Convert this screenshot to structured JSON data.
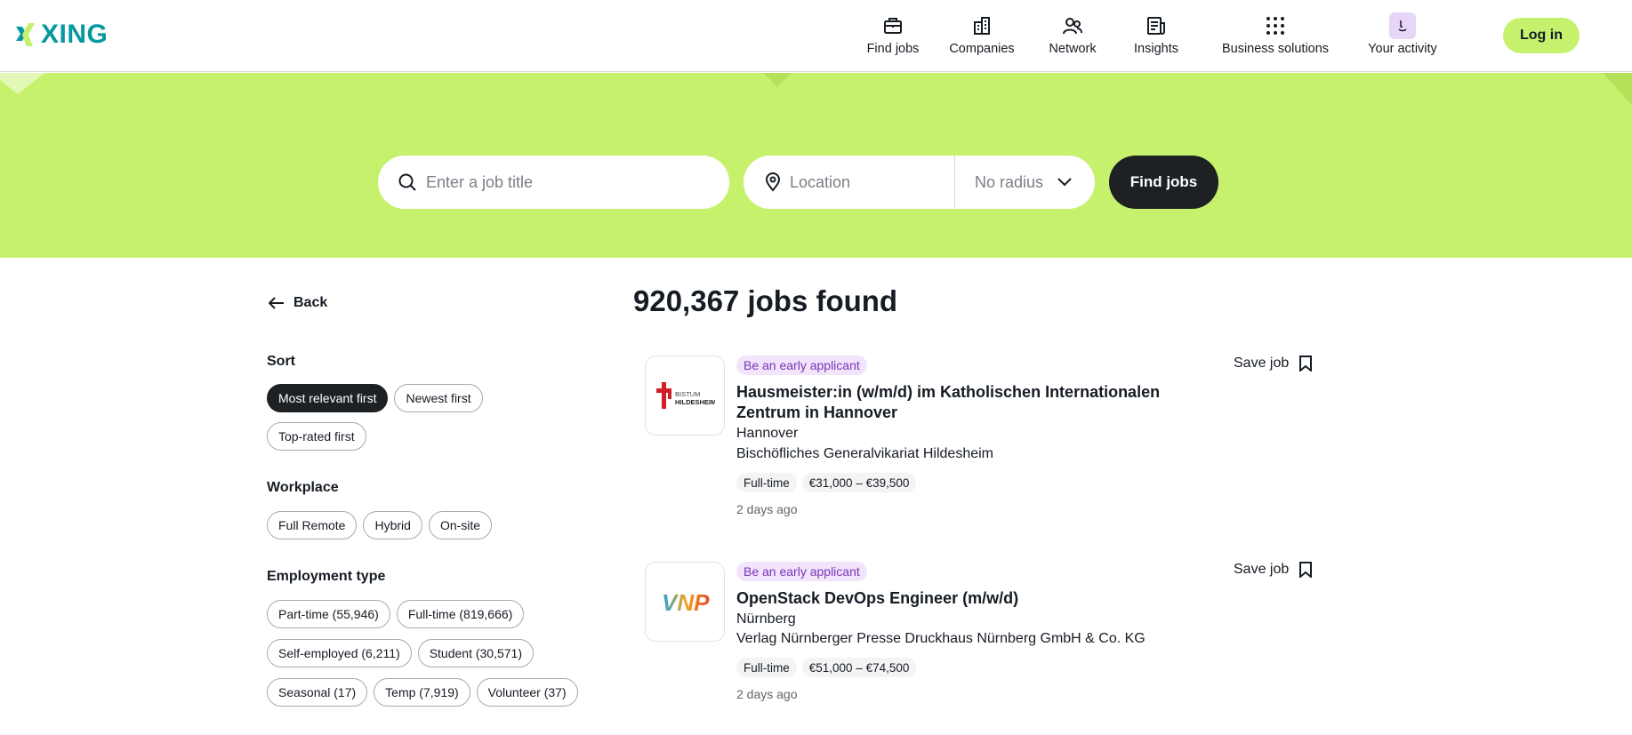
{
  "header": {
    "logo_text": "XING",
    "nav": [
      {
        "label": "Find jobs",
        "icon": "briefcase-icon"
      },
      {
        "label": "Companies",
        "icon": "building-icon"
      },
      {
        "label": "Network",
        "icon": "people-icon"
      },
      {
        "label": "Insights",
        "icon": "newspaper-icon"
      },
      {
        "label": "Business solutions",
        "icon": "grid-dots-icon"
      },
      {
        "label": "Your activity",
        "icon": "activity-face-icon"
      }
    ],
    "login_label": "Log in"
  },
  "search": {
    "job_placeholder": "Enter a job title",
    "location_placeholder": "Location",
    "radius_label": "No radius",
    "find_label": "Find jobs"
  },
  "sidebar": {
    "back_label": "Back",
    "sort": {
      "title": "Sort",
      "options": [
        "Most relevant first",
        "Newest first",
        "Top-rated first"
      ],
      "selected": "Most relevant first"
    },
    "workplace": {
      "title": "Workplace",
      "options": [
        "Full Remote",
        "Hybrid",
        "On-site"
      ]
    },
    "employment": {
      "title": "Employment type",
      "options": [
        "Part-time (55,946)",
        "Full-time (819,666)",
        "Self-employed (6,211)",
        "Student (30,571)",
        "Seasonal (17)",
        "Temp (7,919)",
        "Volunteer (37)"
      ]
    }
  },
  "results": {
    "title": "920,367 jobs found",
    "jobs": [
      {
        "badge": "Be an early applicant",
        "title": "Hausmeister:in (w/m/d) im Katholischen Internationalen Zentrum in Hannover",
        "location": "Hannover",
        "company": "Bischöfliches Generalvikariat Hildesheim",
        "tags": [
          "Full-time",
          "€31,000 – €39,500"
        ],
        "posted": "2 days ago",
        "save_label": "Save job",
        "logo_text_1": "BISTUM",
        "logo_text_2": "HILDESHEIM"
      },
      {
        "badge": "Be an early applicant",
        "title": "OpenStack DevOps Engineer (m/w/d)",
        "location": "Nürnberg",
        "company": "Verlag Nürnberger Presse Druckhaus Nürnberg GmbH & Co. KG",
        "tags": [
          "Full-time",
          "€51,000 – €74,500"
        ],
        "posted": "2 days ago",
        "save_label": "Save job",
        "logo_text_1": "VNP"
      }
    ]
  },
  "colors": {
    "brand_green": "#c6f16d",
    "brand_teal": "#0698a0",
    "dark": "#1d2124",
    "badge_purple": "#7b35b7"
  }
}
